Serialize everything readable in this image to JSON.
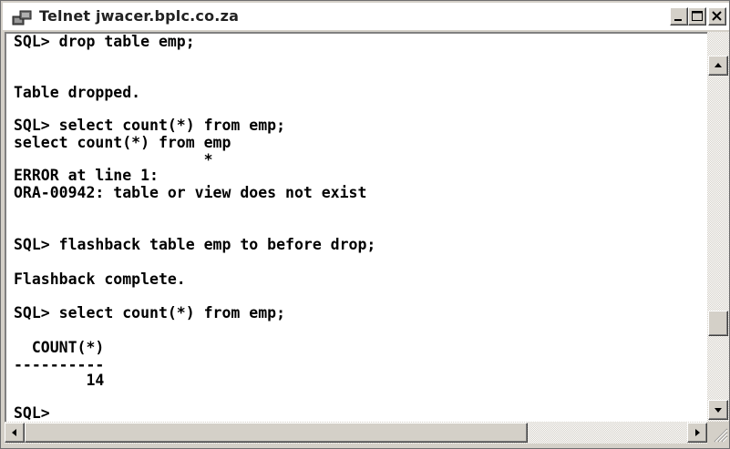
{
  "window": {
    "title": "Telnet jwacer.bplc.co.za",
    "icon": "telnet-app-icon"
  },
  "title_buttons": {
    "minimize": "minimize-icon",
    "maximize": "maximize-icon",
    "close": "close-icon"
  },
  "console": {
    "lines": [
      "SQL> drop table emp;",
      "",
      "Table dropped.",
      "",
      "SQL> select count(*) from emp;",
      "select count(*) from emp",
      "                     *",
      "ERROR at line 1:",
      "ORA-00942: table or view does not exist",
      "",
      "",
      "SQL> flashback table emp to before drop;",
      "",
      "Flashback complete.",
      "",
      "SQL> select count(*) from emp;",
      "",
      "  COUNT(*)",
      "----------",
      "        14",
      "",
      "SQL>"
    ]
  },
  "scrollbars": {
    "up_icon": "arrow-up-icon",
    "down_icon": "arrow-down-icon",
    "left_icon": "arrow-left-icon",
    "right_icon": "arrow-right-icon",
    "vertical_position": 0.85,
    "horizontal_position": 0.0
  }
}
